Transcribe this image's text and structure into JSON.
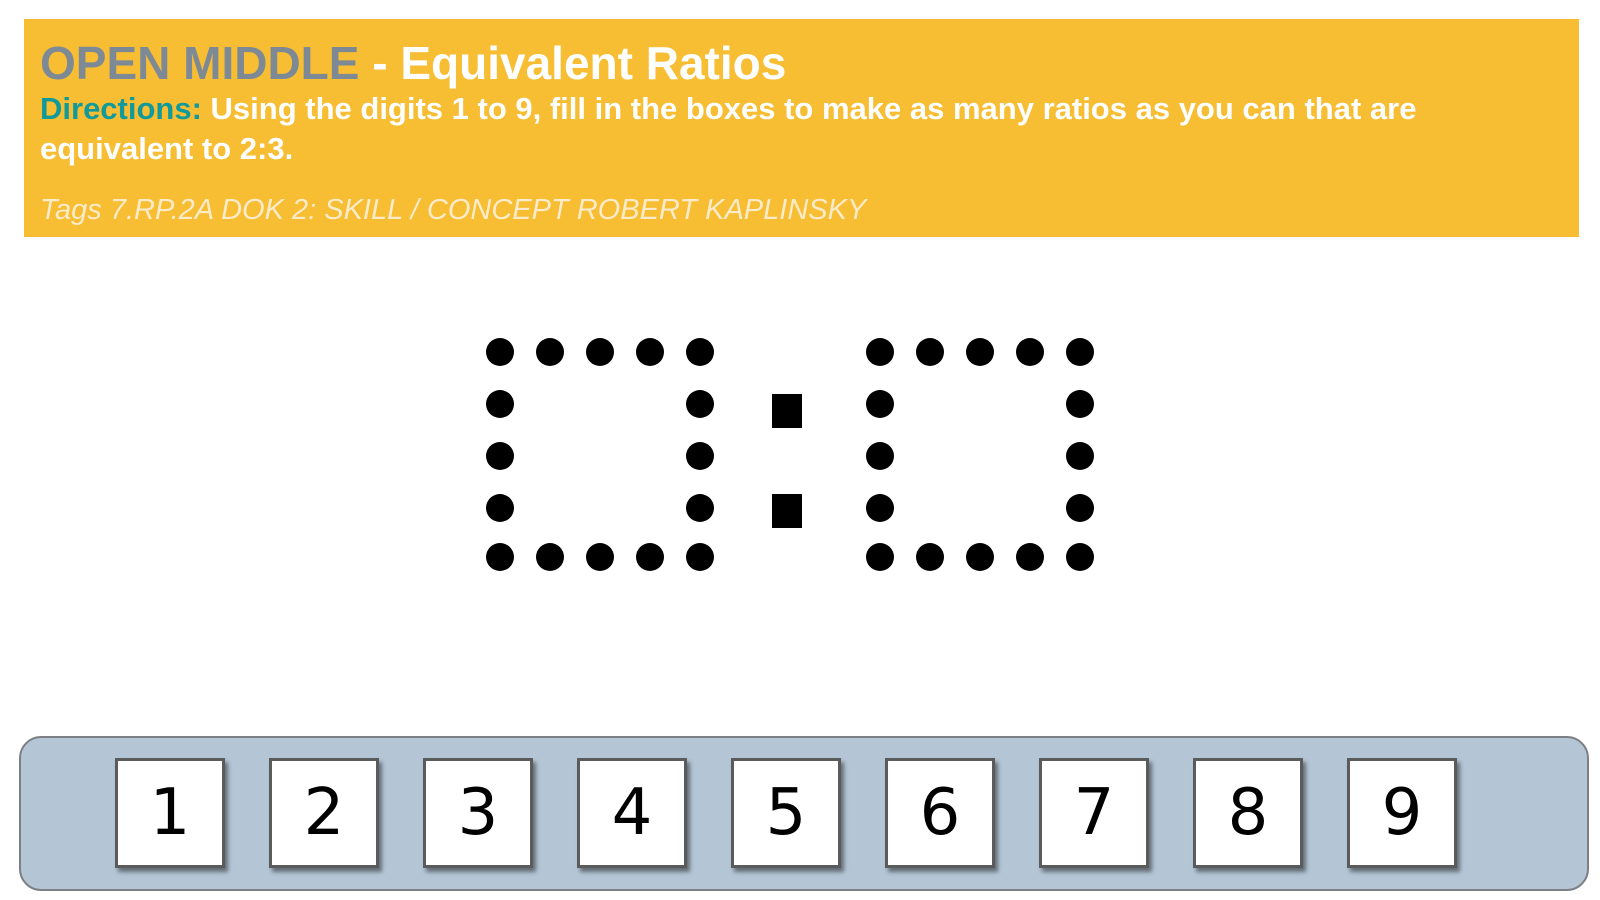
{
  "header": {
    "brand": "OPEN MIDDLE",
    "title_rest": "- Equivalent Ratios",
    "directions_label": "Directions:",
    "directions_text": "Using the digits 1 to 9, fill in the boxes to make as many ratios as you can that are equivalent to 2:3.",
    "tags": "Tags 7.RP.2A DOK 2: SKILL / CONCEPT ROBERT KAPLINSKY"
  },
  "colors": {
    "banner": "#F7BD33",
    "brand": "#7D8A96",
    "directions_label": "#129A9A",
    "tray": "#B4C6D6"
  },
  "digit_tiles": [
    "1",
    "2",
    "3",
    "4",
    "5",
    "6",
    "7",
    "8",
    "9"
  ]
}
